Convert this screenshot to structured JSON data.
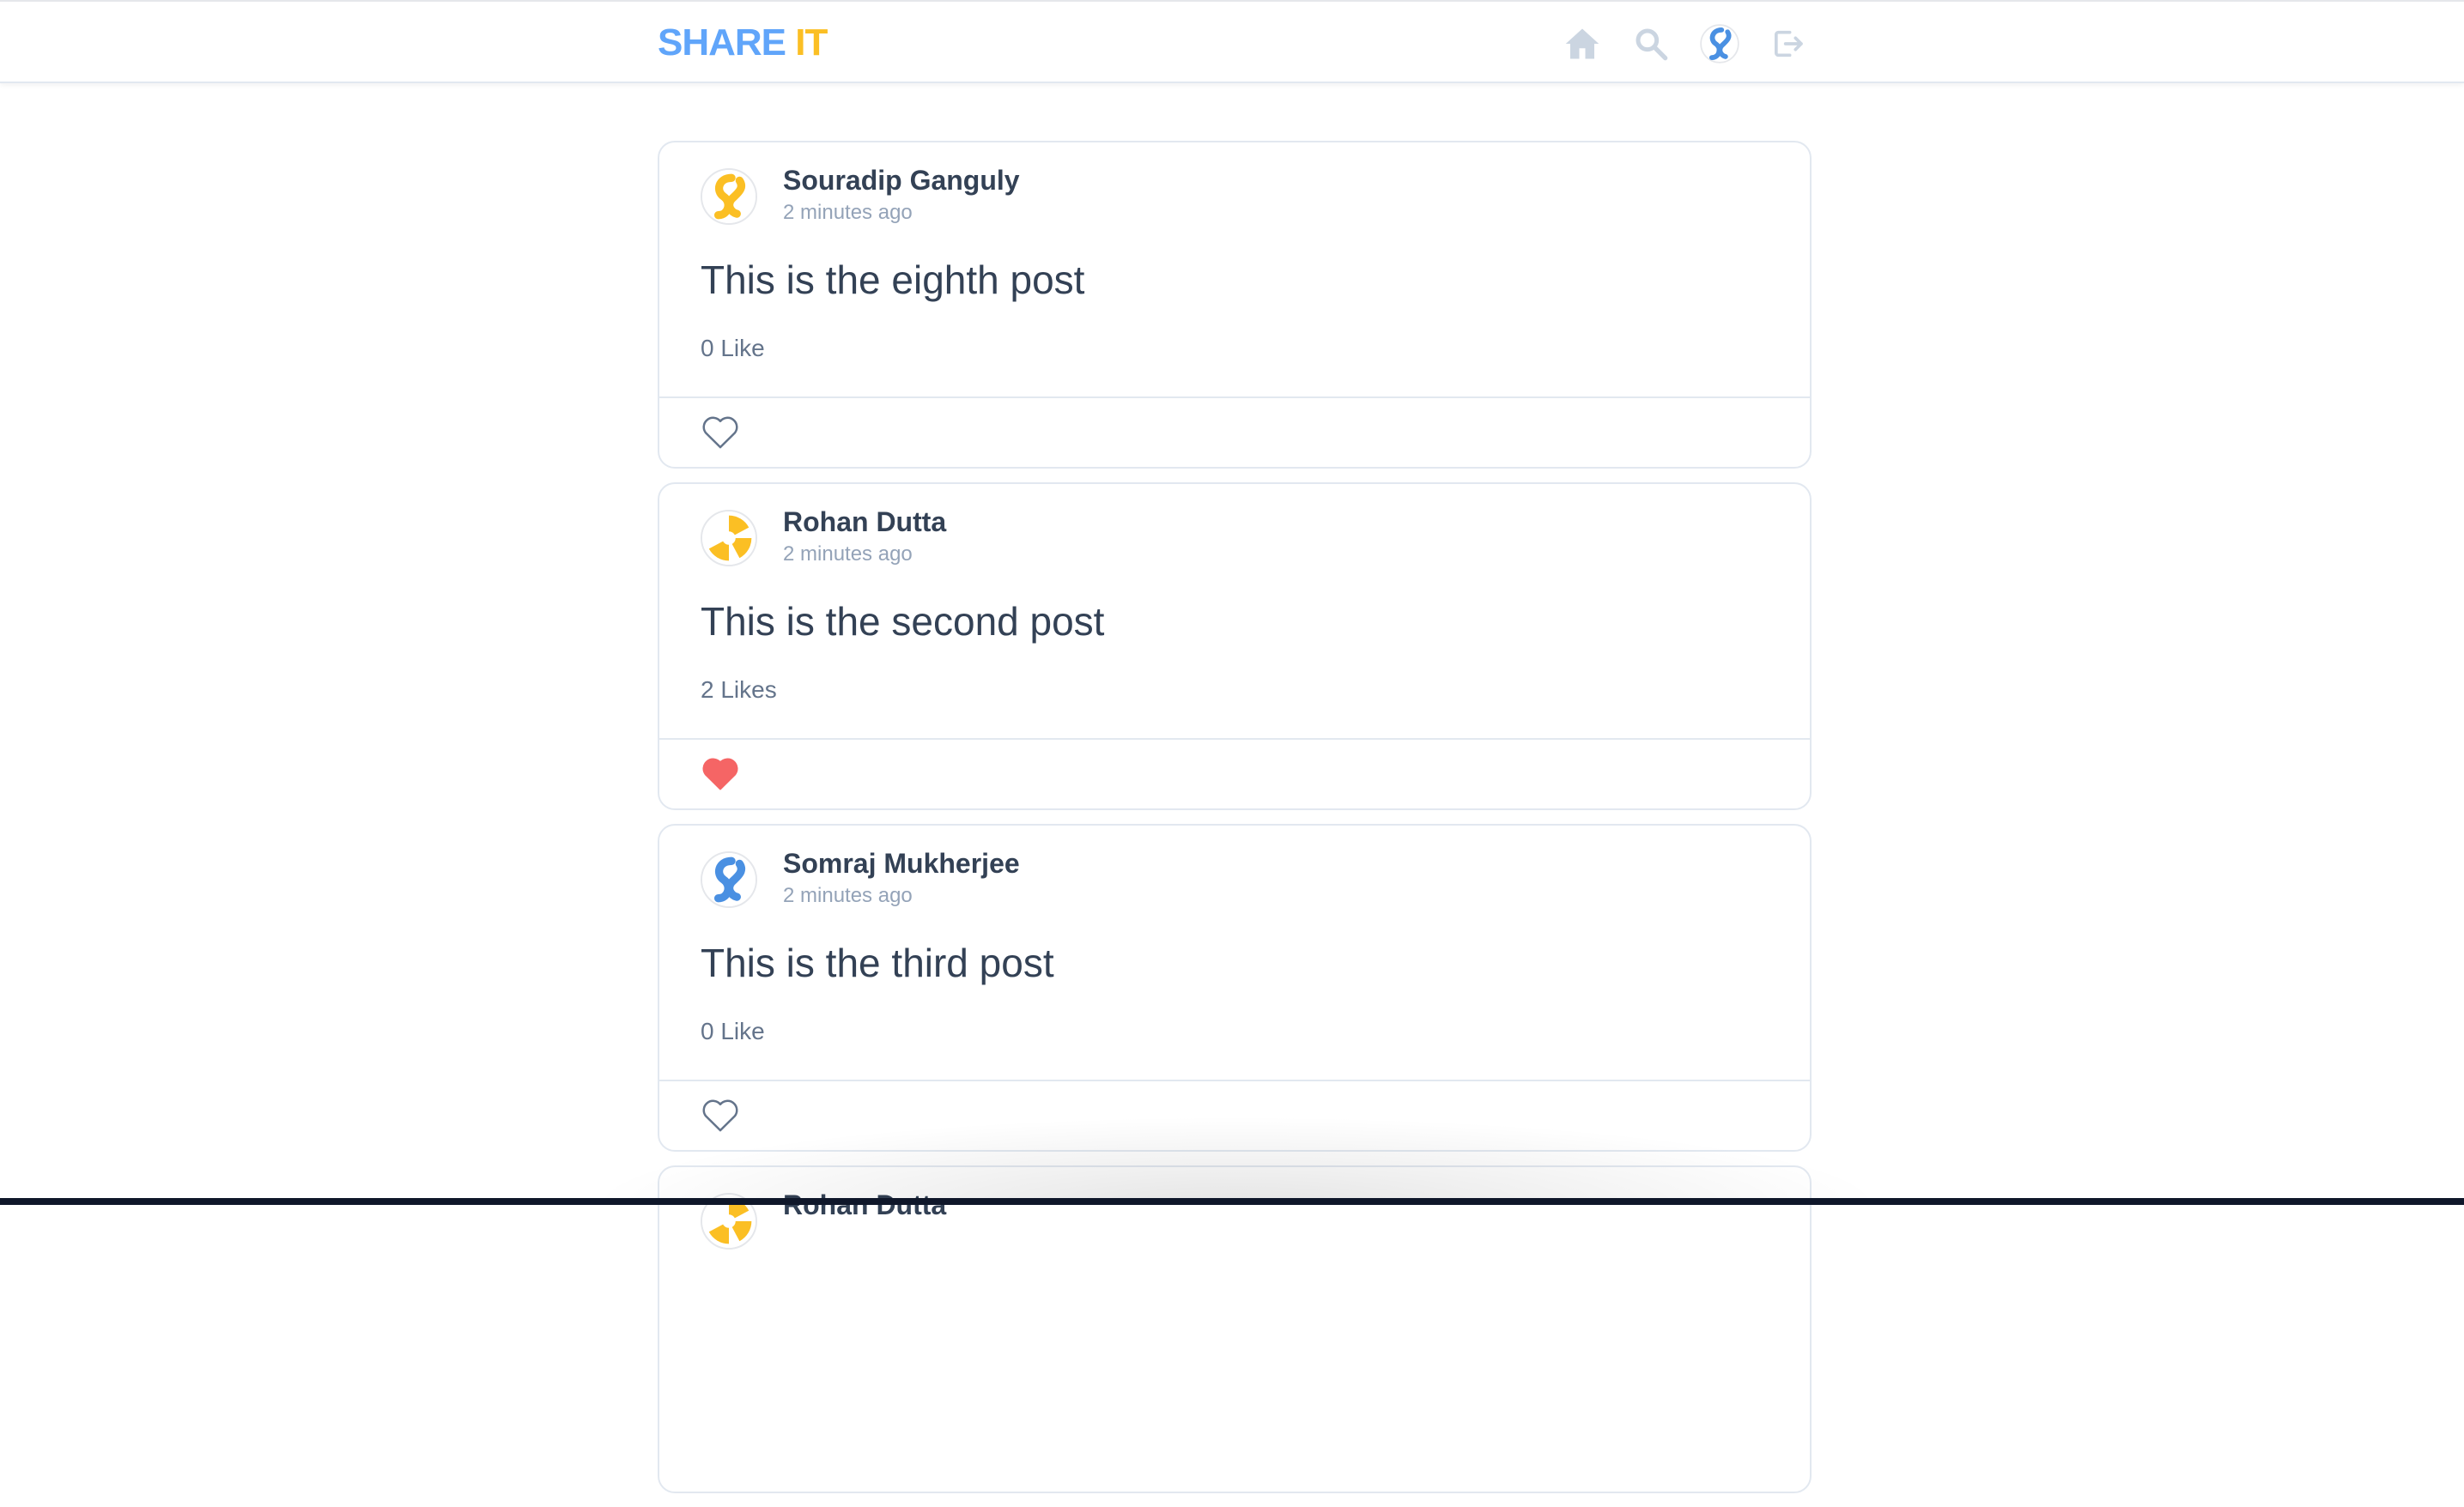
{
  "brand": {
    "part1": "SHARE",
    "part2": "IT",
    "color1": "#60a5fa",
    "color2": "#fbbf24"
  },
  "nav": [
    {
      "name": "home-icon",
      "icon": "home"
    },
    {
      "name": "search-icon",
      "icon": "search"
    },
    {
      "name": "profile-avatar-icon",
      "icon": "avatar-blue"
    },
    {
      "name": "logout-icon",
      "icon": "logout"
    }
  ],
  "posts": [
    {
      "author": "Souradip Ganguly",
      "time": "2 minutes ago",
      "text": "This is the eighth post",
      "likes": "0 Like",
      "liked": false,
      "avatar": "yellow-swirl"
    },
    {
      "author": "Rohan Dutta",
      "time": "2 minutes ago",
      "text": "This is the second post",
      "likes": "2 Likes",
      "liked": true,
      "avatar": "yellow-pinwheel"
    },
    {
      "author": "Somraj Mukherjee",
      "time": "2 minutes ago",
      "text": "This is the third post",
      "likes": "0 Like",
      "liked": false,
      "avatar": "blue-swirl"
    },
    {
      "author": "Rohan Dutta",
      "time": "",
      "text": "",
      "likes": "",
      "liked": false,
      "avatar": "yellow-pinwheel"
    }
  ],
  "colors": {
    "liked_heart": "#f56565",
    "outline_heart": "#64748b",
    "icon_gray": "#cbd5e1"
  }
}
